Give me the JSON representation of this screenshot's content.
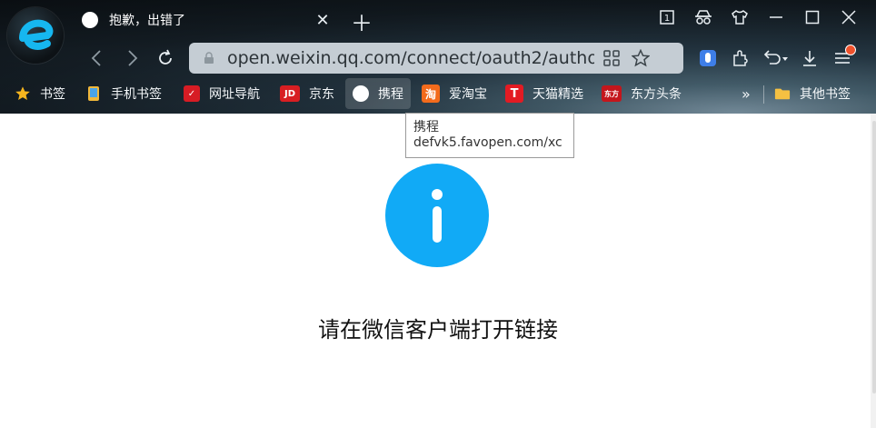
{
  "tab": {
    "title": "抱歉，出错了"
  },
  "address_bar": {
    "url": "open.weixin.qq.com/connect/oauth2/authorize..."
  },
  "bookmarks": [
    {
      "label": "书签",
      "icon": "star-icon"
    },
    {
      "label": "手机书签",
      "icon": "phone-icon"
    },
    {
      "label": "网址导航",
      "icon": "site-nav-icon"
    },
    {
      "label": "京东",
      "icon": "jd-icon",
      "badge": "JD"
    },
    {
      "label": "携程",
      "icon": "circle-icon"
    },
    {
      "label": "爱淘宝",
      "icon": "taobao-icon",
      "badge": "淘"
    },
    {
      "label": "天猫精选",
      "icon": "tmall-icon",
      "badge": "T"
    },
    {
      "label": "东方头条",
      "icon": "dongfang-icon",
      "badge": "东方"
    },
    {
      "label": "»",
      "icon": "more-icon"
    },
    {
      "label": "其他书签",
      "icon": "folder-icon"
    }
  ],
  "tooltip": {
    "line1": "携程",
    "line2": "defvk5.favopen.com/xc"
  },
  "page": {
    "info_glyph": "i",
    "message": "请在微信客户端打开链接"
  },
  "colors": {
    "accent": "#11aaf6",
    "omnibox_bg": "#c5cdd4",
    "tab_favicon": "#ffffff"
  }
}
